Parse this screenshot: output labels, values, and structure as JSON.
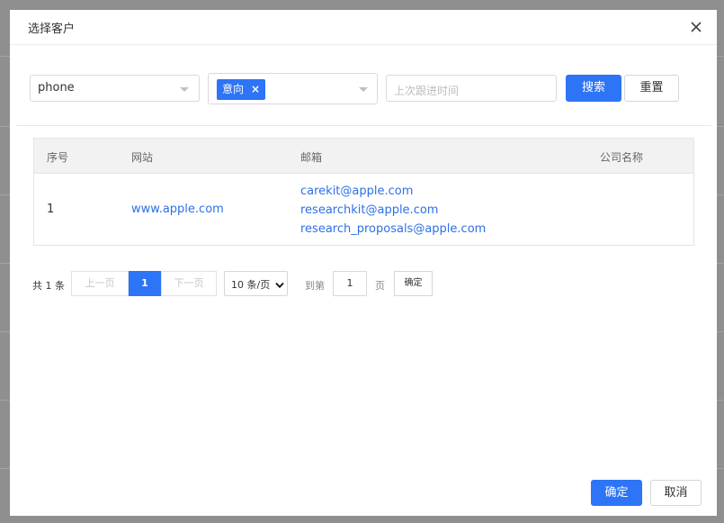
{
  "dialog": {
    "title": "选择客户",
    "close_icon": "close-icon"
  },
  "filters": {
    "field_select": {
      "value": "phone",
      "icon": "chevron-down-icon"
    },
    "intent_select": {
      "tags": [
        "意向"
      ],
      "tag_remove_symbol": "×",
      "icon": "chevron-down-icon"
    },
    "followup_time": {
      "placeholder": "上次跟进时间"
    },
    "search_label": "搜索",
    "reset_label": "重置"
  },
  "table": {
    "columns": [
      "序号",
      "网站",
      "邮箱",
      "公司名称"
    ],
    "rows": [
      {
        "index": "1",
        "website": "www.apple.com",
        "emails": [
          "carekit@apple.com",
          "researchkit@apple.com",
          "research_proposals@apple.com"
        ],
        "company": ""
      }
    ]
  },
  "pagination": {
    "total_text": "共 1 条",
    "prev_label": "上一页",
    "current_page": "1",
    "next_label": "下一页",
    "page_size": "10 条/页",
    "goto_prefix": "到第",
    "goto_value": "1",
    "goto_suffix": "页",
    "goto_confirm": "确定"
  },
  "footer": {
    "confirm_label": "确定",
    "cancel_label": "取消"
  },
  "colors": {
    "primary": "#2d74f6",
    "link": "#2d6fe8"
  }
}
